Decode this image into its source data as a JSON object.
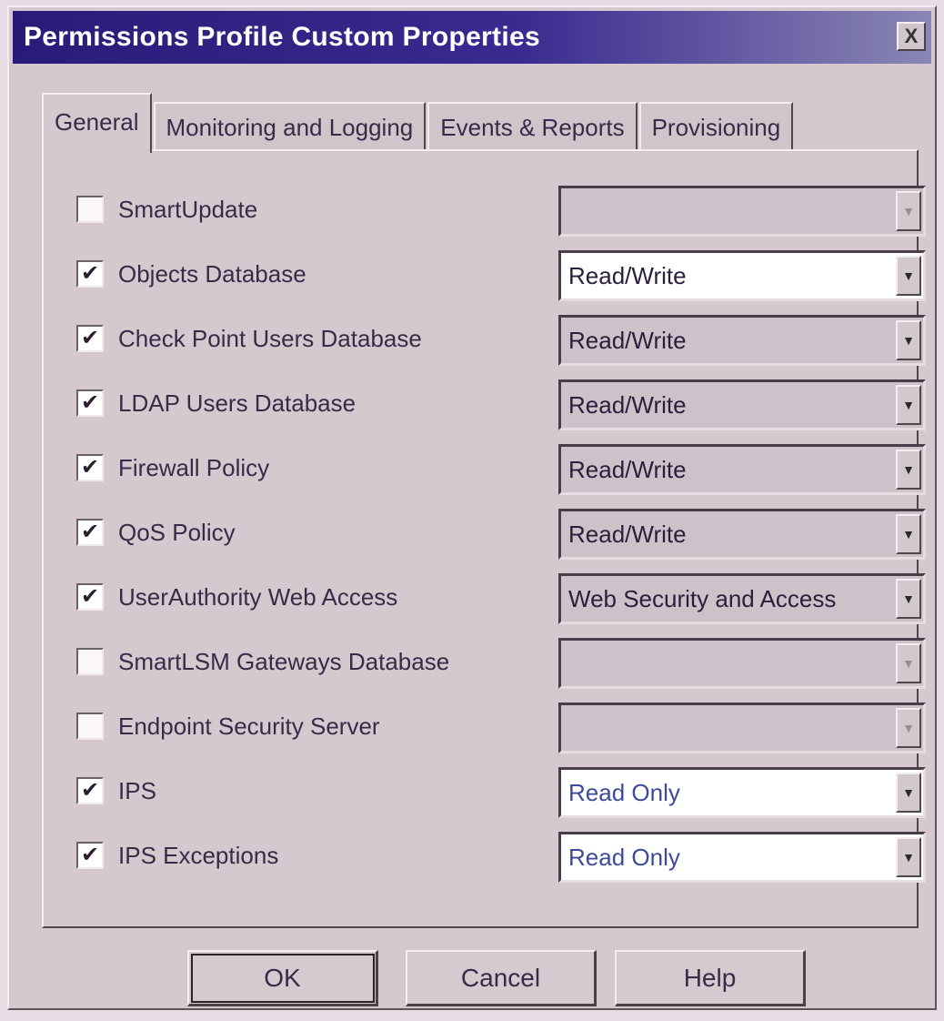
{
  "window": {
    "title": "Permissions Profile Custom Properties",
    "close_glyph": "X"
  },
  "tabs": [
    {
      "label": "General",
      "active": true
    },
    {
      "label": "Monitoring and Logging",
      "active": false
    },
    {
      "label": "Events & Reports",
      "active": false
    },
    {
      "label": "Provisioning",
      "active": false
    }
  ],
  "permissions": [
    {
      "label": "SmartUpdate",
      "checked": false,
      "value": "",
      "enabled": false
    },
    {
      "label": "Objects Database",
      "checked": true,
      "value": "Read/Write",
      "enabled": true
    },
    {
      "label": "Check Point Users Database",
      "checked": true,
      "value": "Read/Write",
      "enabled": false
    },
    {
      "label": "LDAP Users Database",
      "checked": true,
      "value": "Read/Write",
      "enabled": false
    },
    {
      "label": "Firewall Policy",
      "checked": true,
      "value": "Read/Write",
      "enabled": false
    },
    {
      "label": "QoS Policy",
      "checked": true,
      "value": "Read/Write",
      "enabled": false
    },
    {
      "label": "UserAuthority Web Access",
      "checked": true,
      "value": "Web Security and Access",
      "enabled": false
    },
    {
      "label": "SmartLSM Gateways Database",
      "checked": false,
      "value": "",
      "enabled": false
    },
    {
      "label": "Endpoint Security Server",
      "checked": false,
      "value": "",
      "enabled": false
    },
    {
      "label": "IPS",
      "checked": true,
      "value": "Read Only",
      "enabled": true
    },
    {
      "label": "IPS Exceptions",
      "checked": true,
      "value": "Read Only",
      "enabled": true
    }
  ],
  "buttons": {
    "ok": "OK",
    "cancel": "Cancel",
    "help": "Help"
  },
  "icons": {
    "check_glyph": "✔",
    "dropdown_glyph": "▼"
  }
}
